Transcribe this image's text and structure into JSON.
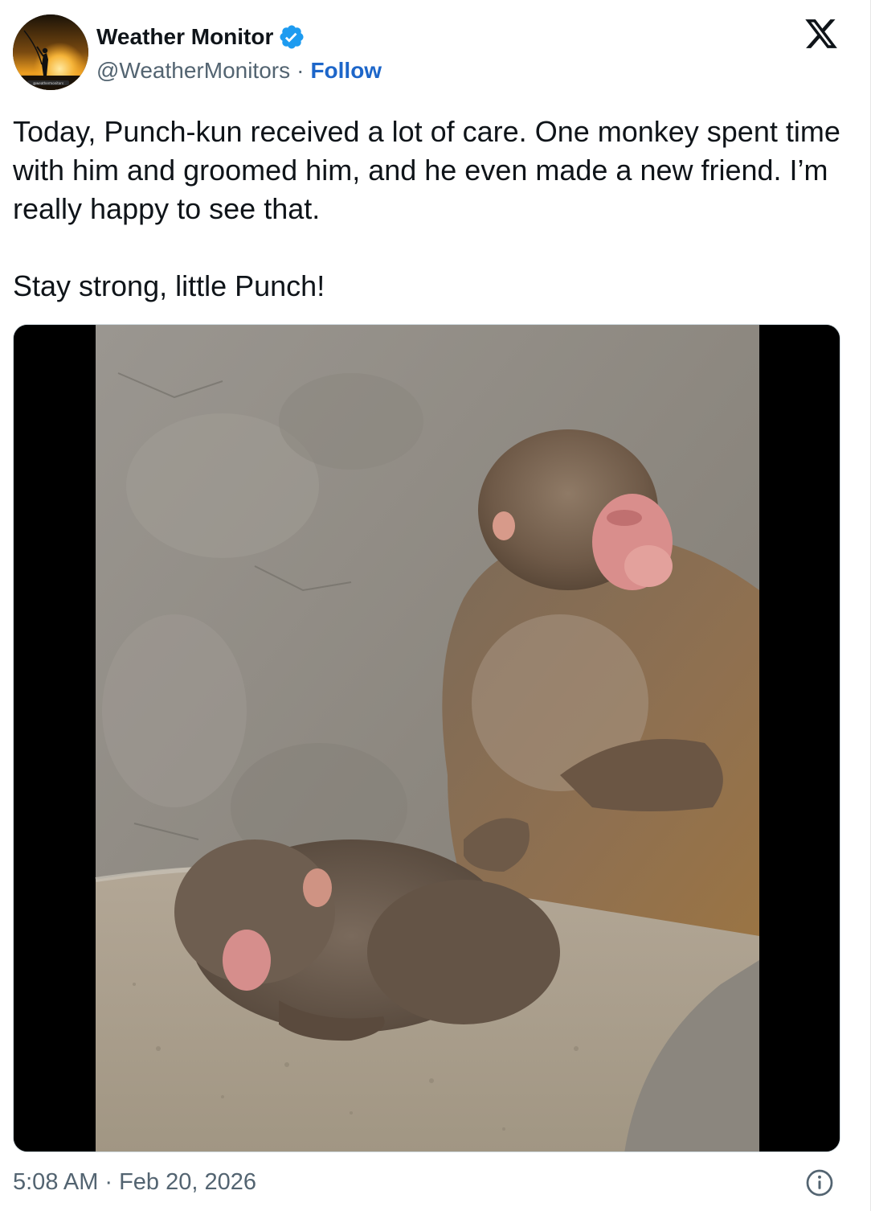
{
  "author": {
    "display_name": "Weather Monitor",
    "handle": "@WeatherMonitors",
    "separator": "·",
    "follow_label": "Follow",
    "avatar_caption": "@weathermonitors",
    "verified": true
  },
  "tweet": {
    "paragraphs": [
      "Today, Punch-kun received a lot of care. One monkey spent time with him and groomed him, and he even made a new friend. I’m really happy to see that.",
      "Stay strong, little Punch!"
    ]
  },
  "footer": {
    "time": "5:08 AM",
    "separator": "·",
    "date": "Feb 20, 2026"
  },
  "icons": {
    "brand": "x-logo-icon",
    "verified": "verified-badge-icon",
    "info": "info-icon"
  },
  "colors": {
    "link": "#1d66c9",
    "verified": "#1d9bf0",
    "secondary_text": "#536471",
    "primary_text": "#0f1419"
  }
}
